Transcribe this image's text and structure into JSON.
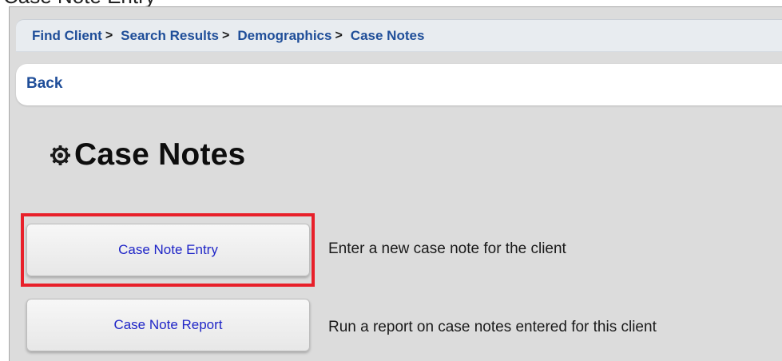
{
  "caption": "Case Note Entry",
  "breadcrumb": [
    {
      "label": "Find Client",
      "sep": ">"
    },
    {
      "label": "Search Results",
      "sep": ">"
    },
    {
      "label": "Demographics",
      "sep": ">"
    },
    {
      "label": "Case Notes",
      "sep": ""
    }
  ],
  "back_label": "Back",
  "page_title": "Case Notes",
  "actions": [
    {
      "label": "Case Note Entry",
      "description": "Enter a new case note for the client"
    },
    {
      "label": "Case Note Report",
      "description": "Run a report on case notes entered for this client"
    }
  ],
  "colors": {
    "link": "#1f4e99",
    "button_text": "#1f25c7",
    "highlight": "#e8202a",
    "background": "#dcdcdc"
  },
  "icons": {
    "title_icon": "gear-icon"
  }
}
